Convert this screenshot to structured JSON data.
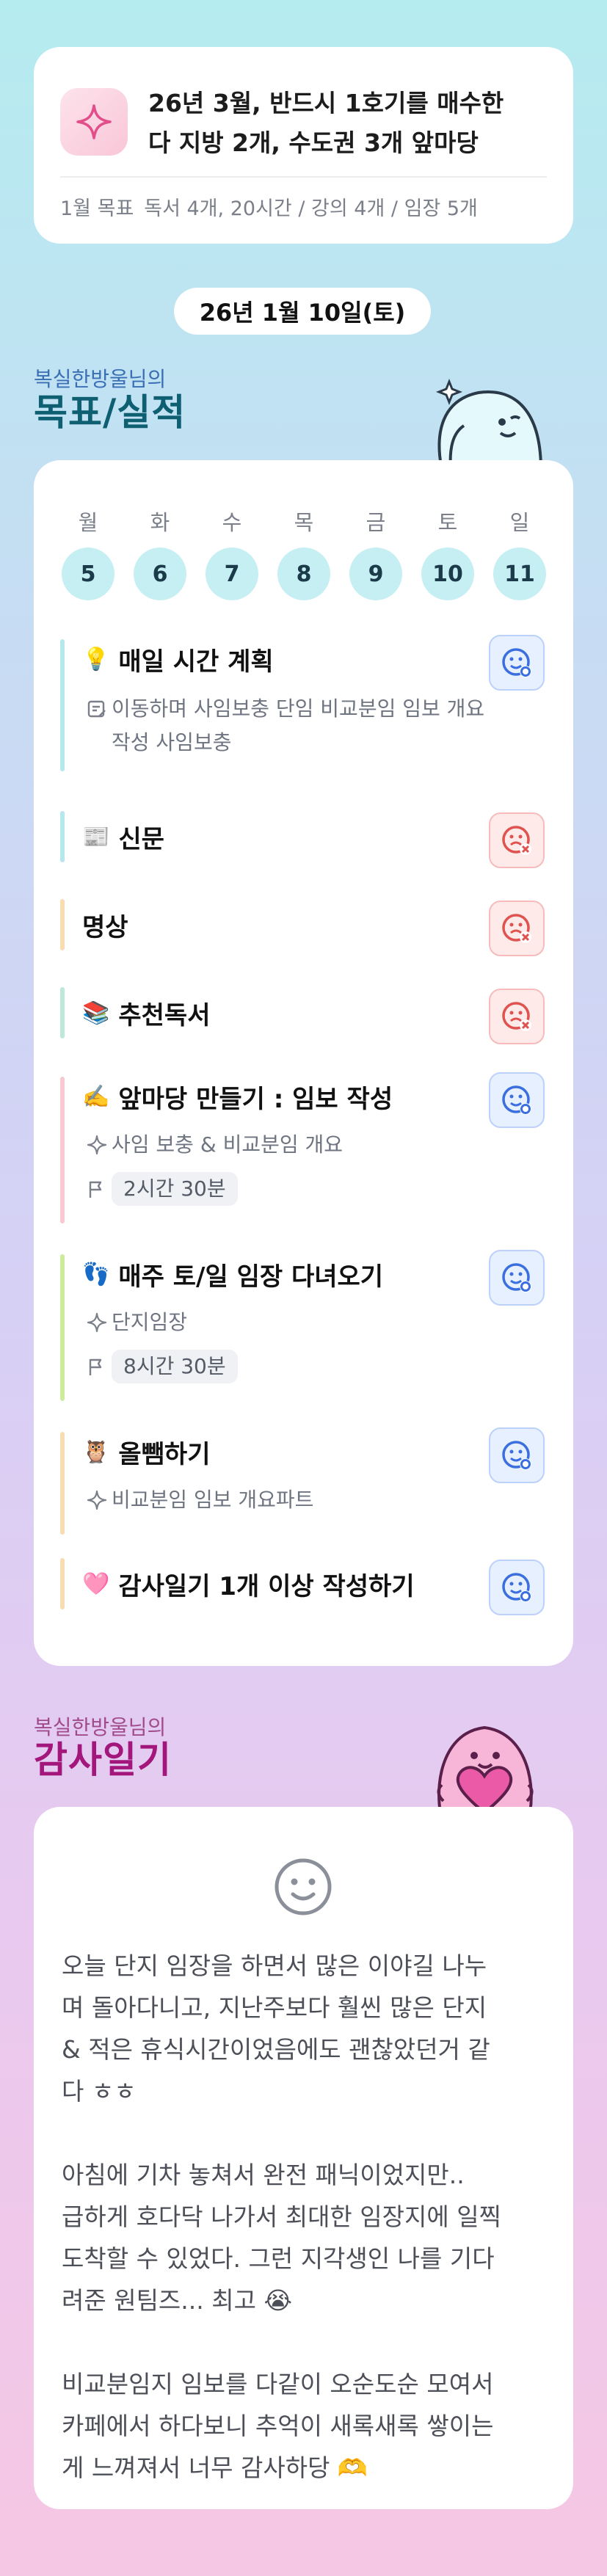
{
  "goal": {
    "icon": "sparkle-icon",
    "line1": "26년 3월, 반드시 1호기를 매수한",
    "line2": "다 지방 2개, 수도권 3개 앞마당",
    "month_label": "1월 목표",
    "month_detail": "독서 4개, 20시간 / 강의 4개 / 임장 5개"
  },
  "date": "26년 1월 10일(토)",
  "goals_section": {
    "subtitle": "복실한방울님의",
    "title": "목표/실적"
  },
  "week": {
    "labels": [
      "월",
      "화",
      "수",
      "목",
      "금",
      "토",
      "일"
    ],
    "days": [
      "5",
      "6",
      "7",
      "8",
      "9",
      "10",
      "11"
    ]
  },
  "tasks": [
    {
      "emoji": "💡",
      "title": "매일 시간 계획",
      "status": "done-icon",
      "note_icon": "memo-icon",
      "note1": "이동하며 사임보충 단임 비교분임 임보 개요",
      "note2": "작성 사임보충",
      "color": "#b6e7ef"
    },
    {
      "emoji": "📰",
      "title": "신문",
      "status": "fail-icon",
      "color": "#b6e7ef"
    },
    {
      "emoji": "",
      "title": "명상",
      "status": "fail-icon",
      "color": "#f8ddb3"
    },
    {
      "emoji": "📚",
      "title": "추천독서",
      "status": "fail-icon",
      "color": "#bfe8dc"
    },
    {
      "emoji": "✍️",
      "title": "앞마당 만들기 : 임보 작성",
      "status": "done-icon",
      "sub": "사임 보충 & 비교분임 개요",
      "time": "2시간 30분",
      "color": "#f7c9d0"
    },
    {
      "emoji": "👣",
      "title": "매주 토/일 임장 다녀오기",
      "status": "done-icon",
      "sub": "단지임장",
      "time": "8시간 30분",
      "color": "#cdeb9c"
    },
    {
      "emoji": "🦉",
      "title": "올뺌하기",
      "status": "done-icon",
      "sub": "비교분임 임보 개요파트",
      "color": "#f8ddb3"
    },
    {
      "emoji": "🩷",
      "title": "감사일기 1개 이상 작성하기",
      "status": "done-icon",
      "color": "#f8ddb3"
    }
  ],
  "gratitude_section": {
    "subtitle": "복실한방울님의",
    "title": "감사일기"
  },
  "diary": {
    "mood_icon": "smile-face-icon",
    "paragraphs": [
      [
        "오늘 단지 임장을 하면서 많은 이야길 나누",
        "며 돌아다니고, 지난주보다 훨씬 많은 단지",
        "& 적은 휴식시간이었음에도 괜찮았던거 같",
        "다 ㅎㅎ"
      ],
      [
        "아침에 기차 놓쳐서 완전 패닉이었지만..",
        "급하게 호다닥 나가서 최대한 임장지에 일찍",
        "도착할 수 있었다. 그런 지각생인 나를 기다",
        "려준 원팀즈... 최고 😭"
      ],
      [
        "비교분임지 임보를 다같이 오순도순 모여서",
        "카페에서 하다보니 추억이 새록새록 쌓이는",
        "게 느껴져서 너무 감사하당 🫶"
      ]
    ]
  },
  "colors": {
    "accent_blue": "#3b6fe0",
    "accent_red": "#e0524d",
    "day_circle": "#c6eff3"
  }
}
